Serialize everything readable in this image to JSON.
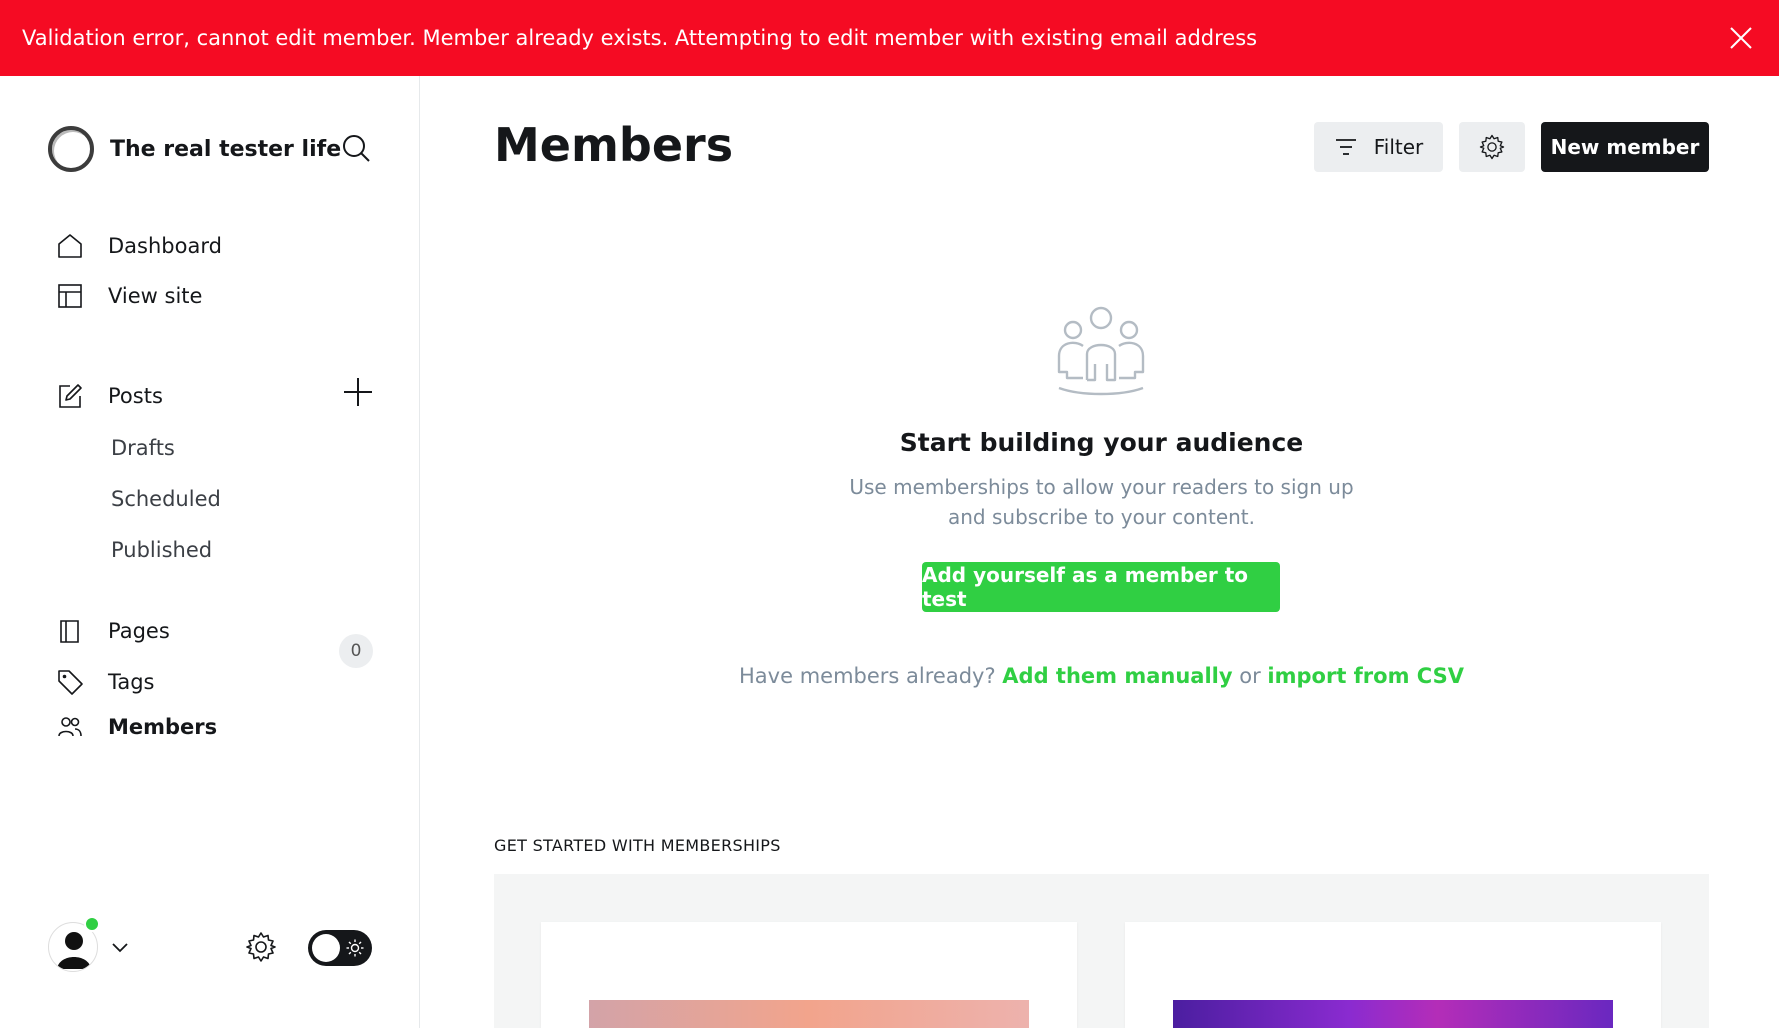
{
  "alert": {
    "message": "Validation error, cannot edit member. Member already exists. Attempting to edit member with existing email address",
    "color": "#f50b23"
  },
  "sidebar": {
    "site_name": "The real tester life",
    "nav": {
      "dashboard": "Dashboard",
      "view_site": "View site",
      "posts": "Posts",
      "drafts": "Drafts",
      "scheduled": "Scheduled",
      "published": "Published",
      "pages": "Pages",
      "tags": "Tags",
      "members": "Members",
      "members_count": "0"
    }
  },
  "header": {
    "title": "Members",
    "filter_label": "Filter",
    "new_member_label": "New member"
  },
  "empty_state": {
    "title": "Start building your audience",
    "text": "Use memberships to allow your readers to sign up and subscribe to your content.",
    "button_label": "Add yourself as a member to test",
    "prompt": "Have members already?",
    "add_manually": "Add them manually",
    "or": "or",
    "import_csv": "import from CSV"
  },
  "get_started": {
    "title": "GET STARTED WITH MEMBERSHIPS"
  },
  "colors": {
    "accent_green": "#30cf43",
    "dark": "#15171a"
  }
}
